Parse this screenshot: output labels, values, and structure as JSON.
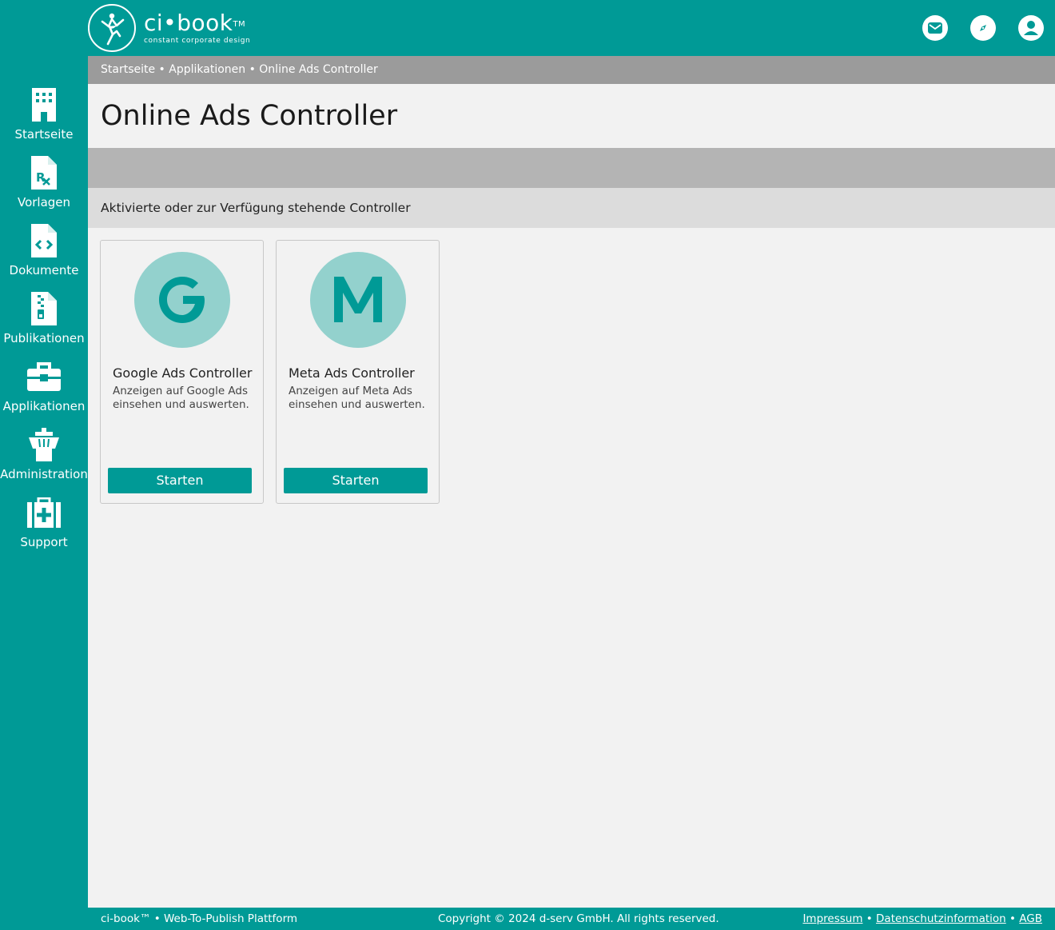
{
  "brand": {
    "name": "ci•book",
    "tm": "TM",
    "tagline": "constant corporate design"
  },
  "header_icons": [
    "mail-icon",
    "compass-icon",
    "user-icon"
  ],
  "sidebar": {
    "items": [
      {
        "label": "Startseite",
        "icon": "building-icon"
      },
      {
        "label": "Vorlagen",
        "icon": "prescription-file-icon"
      },
      {
        "label": "Dokumente",
        "icon": "code-file-icon"
      },
      {
        "label": "Publikationen",
        "icon": "zip-file-icon"
      },
      {
        "label": "Applikationen",
        "icon": "toolbox-icon"
      },
      {
        "label": "Administration",
        "icon": "tower-icon"
      },
      {
        "label": "Support",
        "icon": "medkit-icon"
      }
    ]
  },
  "breadcrumb": "Startseite • Applikationen • Online Ads Controller",
  "page_title": "Online Ads Controller",
  "section_title": "Aktivierte oder zur Verfügung stehende Controller",
  "cards": [
    {
      "letter": "G",
      "title": "Google Ads Controller",
      "description": "Anzeigen auf Google Ads einsehen und auswerten.",
      "button": "Starten"
    },
    {
      "letter": "M",
      "title": "Meta Ads Controller",
      "description": "Anzeigen auf Meta Ads einsehen und auswerten.",
      "button": "Starten"
    }
  ],
  "footer": {
    "left": "ci-book™ • Web-To-Publish Plattform",
    "center": "Copyright © 2024 d-serv GmbH. All rights reserved.",
    "links": [
      "Impressum",
      "Datenschutzinformation",
      "AGB"
    ],
    "separator": " • "
  },
  "colors": {
    "accent": "#009a96",
    "icon_circle": "#93d1cd",
    "breadcrumb_bg": "#9b9b9b",
    "band_bg": "#b4b4b4",
    "section_bg": "#dcdcdc",
    "page_bg": "#f2f2f2"
  }
}
